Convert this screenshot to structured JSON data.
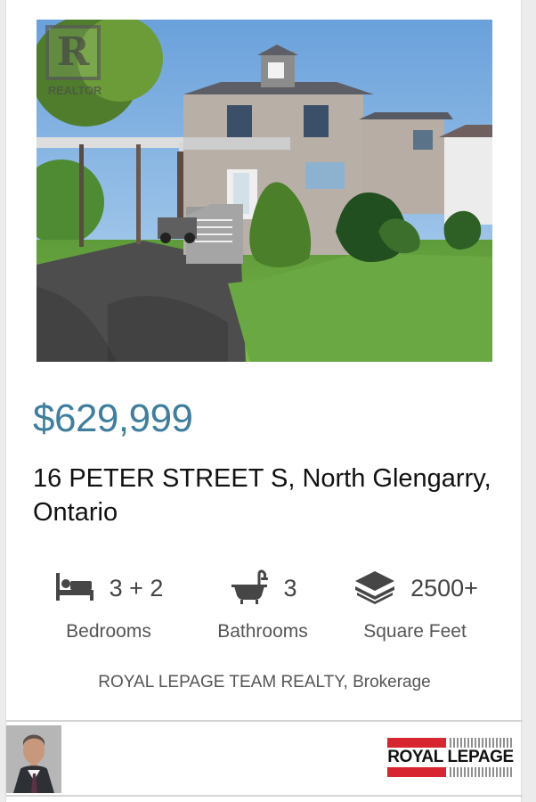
{
  "listing": {
    "price": "$629,999",
    "address": "16 PETER STREET S, North Glengarry, Ontario",
    "brokerage": "ROYAL LEPAGE TEAM REALTY, Brokerage"
  },
  "photo": {
    "watermark": "REALTOR"
  },
  "features": {
    "bedrooms": {
      "value": "3 + 2",
      "label": "Bedrooms",
      "icon": "bed-icon"
    },
    "bathrooms": {
      "value": "3",
      "label": "Bathrooms",
      "icon": "bathtub-icon"
    },
    "square_feet": {
      "value": "2500+",
      "label": "Square Feet",
      "icon": "layers-icon"
    }
  },
  "logo": {
    "text": "ROYAL LEPAGE",
    "red_color": "#d7262f"
  },
  "colors": {
    "price": "#3f7f9d",
    "card_background": "#ffffff",
    "page_background": "#ececec"
  }
}
